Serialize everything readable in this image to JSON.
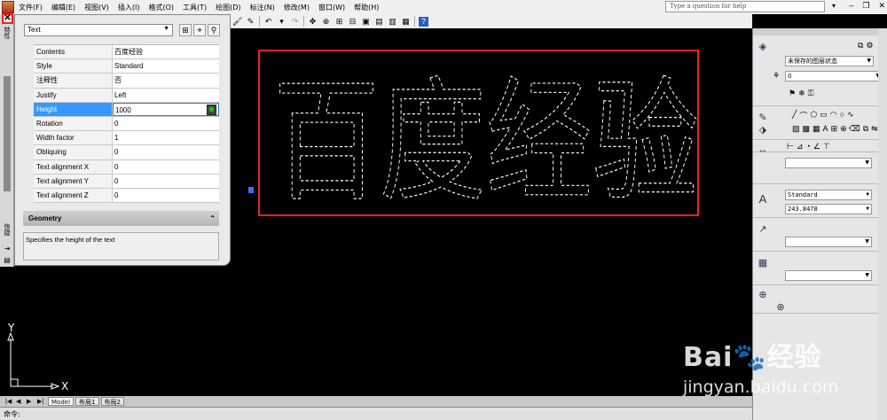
{
  "menubar": {
    "items": [
      "文件(F)",
      "编辑(E)",
      "视图(V)",
      "插入(I)",
      "格式(O)",
      "工具(T)",
      "绘图(D)",
      "标注(N)",
      "修改(M)",
      "窗口(W)",
      "帮助(H)"
    ],
    "help_placeholder": "Type a question for help"
  },
  "left_strip": {
    "top_label": "特性",
    "bottom_label": "快捷"
  },
  "properties": {
    "object_type": "Text",
    "rows": [
      {
        "key": "Contents",
        "value": "百度经验"
      },
      {
        "key": "Style",
        "value": "Standard"
      },
      {
        "key": "注释性",
        "value": "否"
      },
      {
        "key": "Justify",
        "value": "Left"
      },
      {
        "key": "Height",
        "value": "1000"
      },
      {
        "key": "Rotation",
        "value": "0"
      },
      {
        "key": "Width factor",
        "value": "1"
      },
      {
        "key": "Obliquing",
        "value": "0"
      },
      {
        "key": "Text alignment X",
        "value": "0"
      },
      {
        "key": "Text alignment Y",
        "value": "0"
      },
      {
        "key": "Text alignment Z",
        "value": "0"
      }
    ],
    "selected_row": 4,
    "section_title": "Geometry",
    "description": "Specifies the height of the text"
  },
  "canvas": {
    "text": "百度经验",
    "text_color": "#ffffff",
    "highlight_color": "#ee2222",
    "ucs_x": "X",
    "ucs_y": "Y"
  },
  "tabs": {
    "items": [
      "Model",
      "布局1",
      "布局2"
    ],
    "active": 0
  },
  "command_line": {
    "text": "命令:"
  },
  "right_panel": {
    "layer_state": "未保存的图层状态",
    "layer_value": "0",
    "text_style": "Standard",
    "text_height": "243.8478"
  },
  "watermark": {
    "line1": "Bai",
    "line1_suffix": "经验",
    "line2": "jingyan.baidu.com"
  }
}
